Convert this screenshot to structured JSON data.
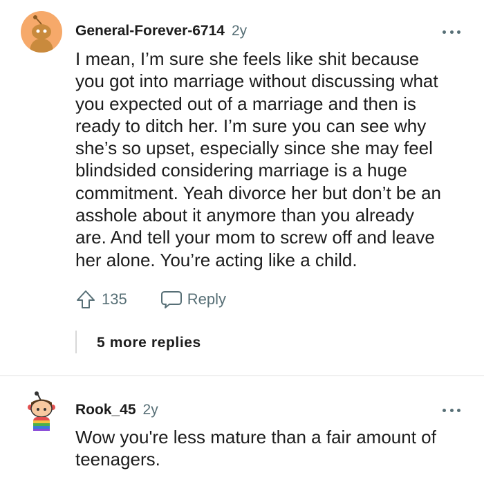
{
  "comments": [
    {
      "username": "General-Forever-6714",
      "age": "2y",
      "lines": [
        "I mean, I’m sure she feels like shit because",
        "you got into marriage without discussing what",
        "you expected out of a marriage and then is",
        "ready to ditch her. I’m sure you can see why",
        "she’s so upset, especially since she may feel",
        "blindsided considering marriage is a huge",
        "commitment. Yeah divorce her but don’t be an",
        "asshole about it anymore than you already",
        "are. And tell your mom to screw off and leave",
        "her alone. You’re acting like a child."
      ],
      "upvotes": "135",
      "reply_label": "Reply",
      "more_replies": "5 more replies"
    },
    {
      "username": "Rook_45",
      "age": "2y",
      "lines": [
        "Wow you're less mature than a fair amount of",
        "teenagers."
      ]
    }
  ],
  "icons": {
    "more": "more-options-icon",
    "upvote": "upvote-arrow-icon",
    "reply": "reply-bubble-icon"
  },
  "colors": {
    "avatar_bg": "#f6a96a",
    "meta_gray": "#576f76",
    "text": "#1c1c1c"
  }
}
